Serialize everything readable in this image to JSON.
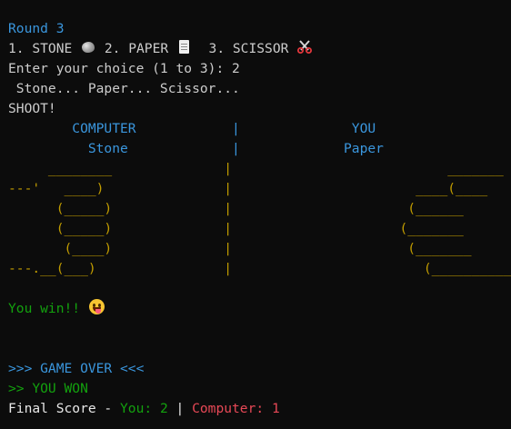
{
  "terminal": {
    "round_line": "Round 3",
    "menu_option_1": "1. STONE",
    "menu_option_2": " 2. PAPER",
    "menu_option_3": "  3. SCISSOR",
    "prompt_text": "Enter your choice (1 to 3): ",
    "prompt_input": "2",
    "chant_line": " Stone... Paper... Scissor...",
    "shoot_line": "SHOOT!",
    "player_header": "        COMPUTER            |              YOU",
    "player_choices": "          Stone             |             Paper",
    "hands_art": [
      "     ________              |                           _______",
      "---'   ____)               |                       ____(____   '---",
      "      (_____)              |                      (______",
      "      (_____)              |                     (_______",
      "       (____)              |                      (_______",
      "---.__(___)                |                        (__________.---"
    ],
    "result_text": "You win!! ",
    "game_over_line": ">>> GAME OVER <<<",
    "winner_line": ">> YOU WON",
    "final_score_label": "Final Score - ",
    "you_score": "You: 2",
    "score_separator": " | ",
    "computer_score": "Computer: 1"
  },
  "icons": {
    "menu_icon_1": "stone-icon",
    "menu_icon_2": "paper-icon",
    "menu_icon_3": "scissors-icon",
    "result_icon": "tongue-smile-icon"
  },
  "colors": {
    "background": "#0c0c0c",
    "text": "#cccccc",
    "cyan": "#3a96dd",
    "amber": "#c19c00",
    "green": "#13a10e",
    "red": "#e74856"
  }
}
